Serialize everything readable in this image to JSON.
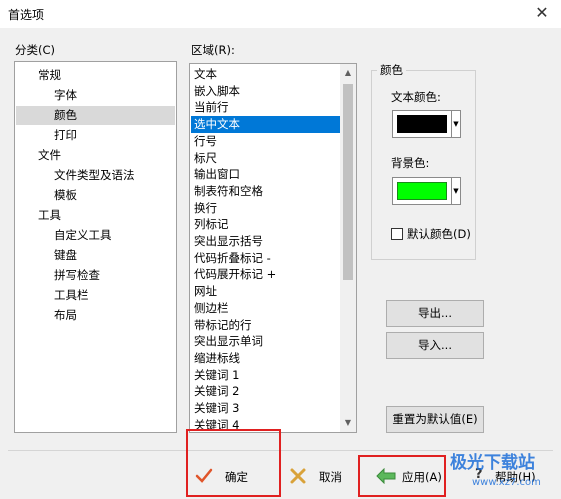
{
  "window": {
    "title": "首选项",
    "close": "✕"
  },
  "category": {
    "label": "分类(C)",
    "items": [
      {
        "label": "常规",
        "level": 0
      },
      {
        "label": "字体",
        "level": 1
      },
      {
        "label": "颜色",
        "level": 1,
        "selected": true
      },
      {
        "label": "打印",
        "level": 1
      },
      {
        "label": "文件",
        "level": 0
      },
      {
        "label": "文件类型及语法",
        "level": 1
      },
      {
        "label": "模板",
        "level": 1
      },
      {
        "label": "工具",
        "level": 0
      },
      {
        "label": "自定义工具",
        "level": 1
      },
      {
        "label": "键盘",
        "level": 1
      },
      {
        "label": "拼写检查",
        "level": 1
      },
      {
        "label": "工具栏",
        "level": 1
      },
      {
        "label": "布局",
        "level": 1
      }
    ]
  },
  "region": {
    "label": "区域(R):",
    "items": [
      "文本",
      "嵌入脚本",
      "当前行",
      "选中文本",
      "行号",
      "标尺",
      "输出窗口",
      "制表符和空格",
      "换行",
      "列标记",
      "突出显示括号",
      "代码折叠标记 -",
      "代码展开标记 +",
      "网址",
      "侧边栏",
      "带标记的行",
      "突出显示单词",
      "缩进标线",
      "关键词 1",
      "关键词 2",
      "关键词 3",
      "关键词 4"
    ],
    "selected_index": 3
  },
  "color": {
    "group_label": "颜色",
    "text_color_label": "文本颜色:",
    "text_color": "#000000",
    "bg_color_label": "背景色:",
    "bg_color": "#00ff00",
    "default_label": "默认颜色(D)",
    "default_checked": false
  },
  "buttons": {
    "export": "导出...",
    "import": "导入...",
    "reset": "重置为默认值(E)",
    "ok": "确定",
    "cancel": "取消",
    "apply": "应用(A)",
    "help": "帮助(H)"
  },
  "watermark": {
    "text": "极光下载站",
    "url": "www.xz7.com"
  }
}
